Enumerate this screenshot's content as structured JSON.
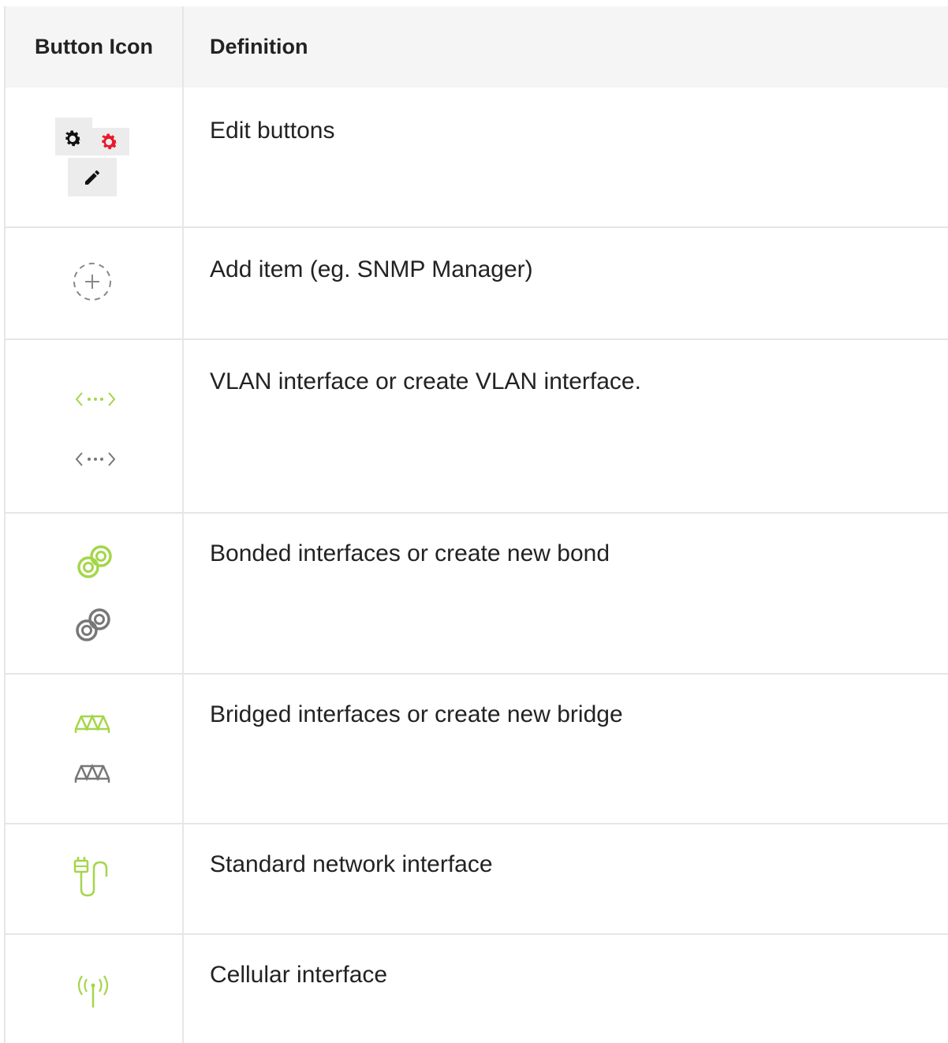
{
  "table": {
    "headers": {
      "icon": "Button Icon",
      "definition": "Definition"
    },
    "rows": [
      {
        "definition": "Edit buttons",
        "icons": [
          "gear-icon",
          "gear-icon",
          "pencil-icon"
        ]
      },
      {
        "definition": "Add item (eg. SNMP Manager)",
        "icons": [
          "add-circle-icon"
        ]
      },
      {
        "definition": "VLAN interface or create VLAN interface.",
        "icons": [
          "vlan-icon",
          "vlan-icon"
        ]
      },
      {
        "definition": "Bonded interfaces or create new bond",
        "icons": [
          "bond-icon",
          "bond-icon"
        ]
      },
      {
        "definition": "Bridged interfaces or create new bridge",
        "icons": [
          "bridge-icon",
          "bridge-icon"
        ]
      },
      {
        "definition": "Standard network interface",
        "icons": [
          "network-plug-icon"
        ]
      },
      {
        "definition": "Cellular interface",
        "icons": [
          "cellular-antenna-icon"
        ]
      }
    ]
  },
  "colors": {
    "active_green": "#a4d64a",
    "inactive_grey": "#777777",
    "alert_red": "#e8192c",
    "header_bg": "#f5f5f5",
    "border": "#e6e6e6"
  }
}
